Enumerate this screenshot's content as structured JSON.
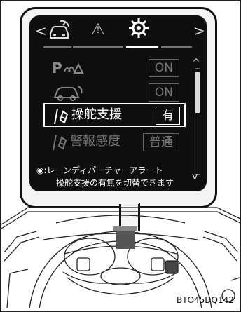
{
  "screen": {
    "nav": {
      "left_chevron": "<",
      "right_chevron": ">"
    },
    "tabs": [
      {
        "icon": "car-gauge-icon",
        "label": ""
      },
      {
        "icon": "warning-triangle-icon",
        "label": "⚠"
      },
      {
        "icon": "gear-icon",
        "label": "⚙"
      }
    ],
    "menu": [
      {
        "id": "parking",
        "icon": "parking-assist-icon",
        "value": "ON"
      },
      {
        "id": "vehicle",
        "icon": "vehicle-outline-icon",
        "value": "ON"
      },
      {
        "id": "steering",
        "icon": "lane-assist-icon",
        "label": "操舵支援",
        "value": "有"
      },
      {
        "id": "sensitivity",
        "icon": "lane-assist-icon",
        "label": "警報感度",
        "value": "普通"
      }
    ],
    "hint_line1": "◉:レーンディパーチャーアラート",
    "hint_line2": "操舵支援の有無を切替できます"
  },
  "figure_code": "BTO45DQ142",
  "colors": {
    "screen_bg": "#0f0f0f",
    "bubble_bg": "#f4f4f4",
    "frame": "#111111"
  }
}
